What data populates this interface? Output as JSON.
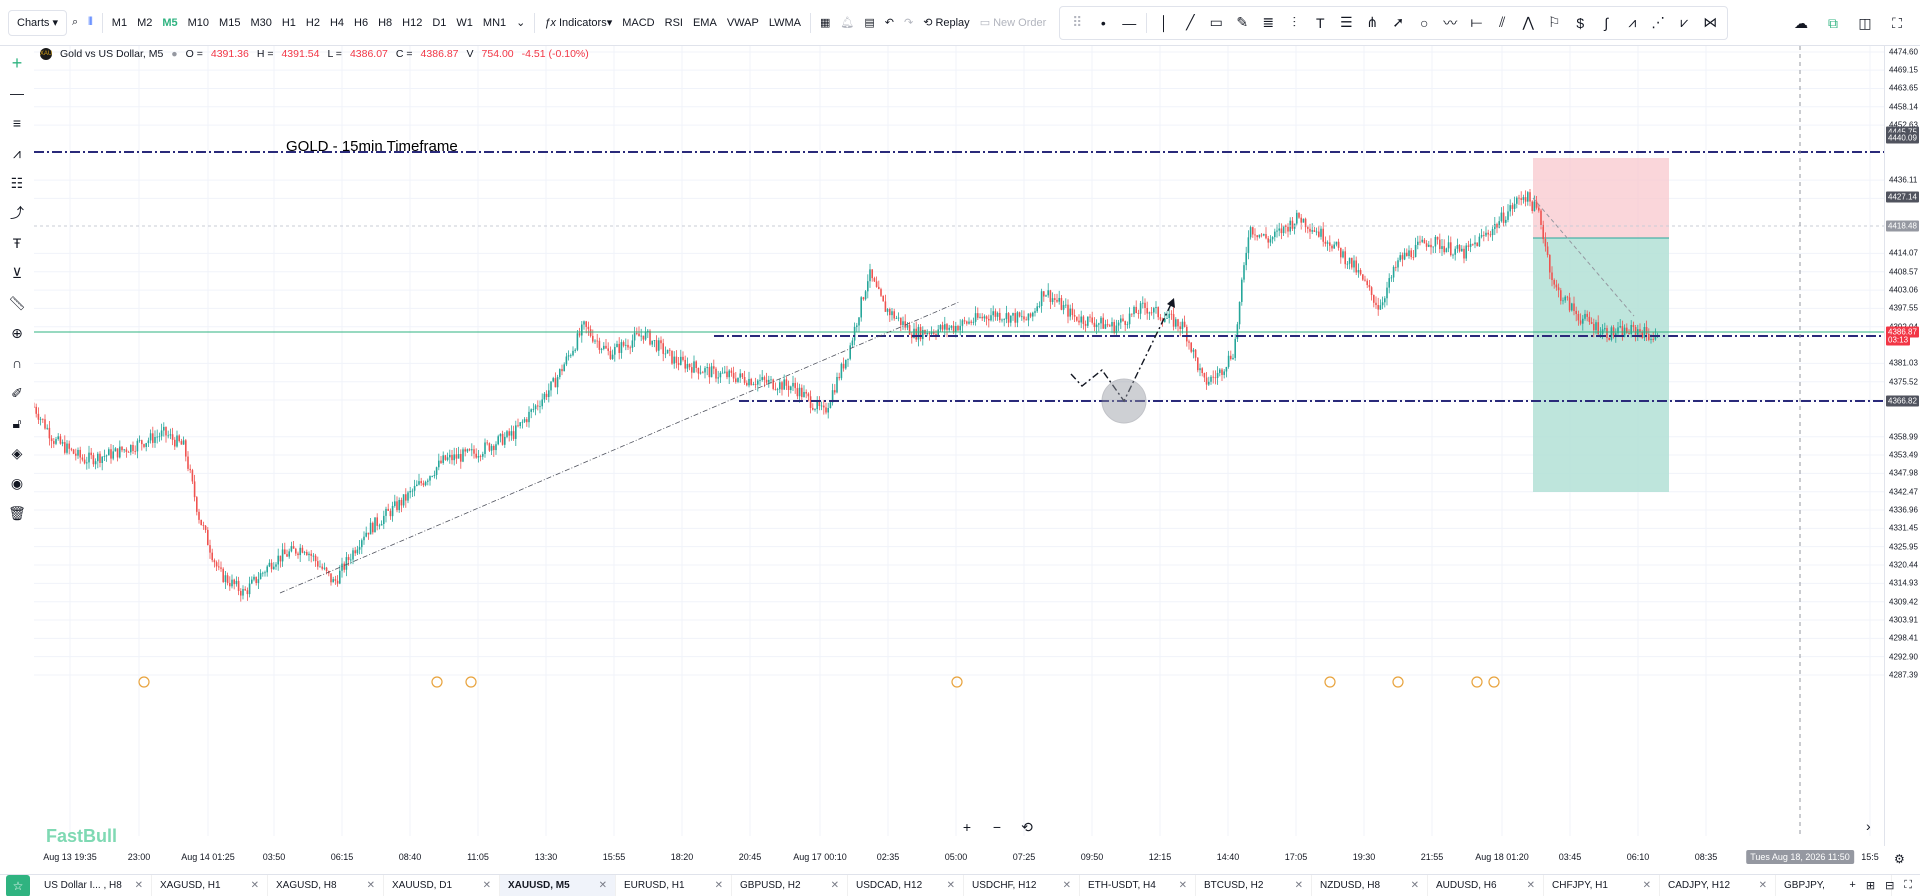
{
  "toolbar": {
    "charts_label": "Charts",
    "timeframes": [
      "M1",
      "M2",
      "M5",
      "M10",
      "M15",
      "M30",
      "H1",
      "H2",
      "H4",
      "H6",
      "H8",
      "H12",
      "D1",
      "W1",
      "MN1"
    ],
    "active_timeframe": "M5",
    "indicators_label": "Indicators",
    "indicators": [
      "MACD",
      "RSI",
      "EMA",
      "VWAP",
      "LWMA"
    ],
    "replay_label": "Replay",
    "new_order_label": "New Order"
  },
  "legend": {
    "symbol": "Gold vs US Dollar, M5",
    "o_label": "O =",
    "o_value": "4391.36",
    "h_label": "H =",
    "h_value": "4391.54",
    "l_label": "L =",
    "l_value": "4386.07",
    "c_label": "C =",
    "c_value": "4386.87",
    "v_label": "V",
    "v_value": "754.00",
    "change": "-4.51 (-0.10%)"
  },
  "annotation_text": "GOLD - 15min Timeframe",
  "watermark": "FastBull",
  "price_axis": {
    "labels": [
      "4474.60",
      "4469.15",
      "4463.65",
      "4458.14",
      "4452.63",
      "4436.11",
      "4430.60",
      "4414.07",
      "4408.57",
      "4403.06",
      "4397.55",
      "4392.04",
      "4381.03",
      "4375.52",
      "4370.01",
      "4358.99",
      "4353.49",
      "4347.98",
      "4342.47",
      "4336.96",
      "4331.45",
      "4325.95",
      "4320.44",
      "4314.93",
      "4309.42",
      "4303.91",
      "4298.41",
      "4292.90",
      "4287.39"
    ],
    "tags": [
      {
        "value": "4445.75",
        "color": "#50535e"
      },
      {
        "value": "4440.09",
        "color": "#50535e"
      },
      {
        "value": "4427.14",
        "color": "#50535e"
      },
      {
        "value": "4418.48",
        "color": "#9598a1"
      },
      {
        "value": "4386.87",
        "color": "#f23645"
      },
      {
        "value": "03:13",
        "color": "#f23645"
      },
      {
        "value": "4366.82",
        "color": "#50535e"
      }
    ]
  },
  "time_axis": {
    "labels": [
      "Aug 13 19:35",
      "23:00",
      "Aug 14 01:25",
      "03:50",
      "06:15",
      "08:40",
      "11:05",
      "13:30",
      "15:55",
      "18:20",
      "20:45",
      "Aug 17 00:10",
      "02:35",
      "05:00",
      "07:25",
      "09:50",
      "12:15",
      "14:40",
      "17:05",
      "19:30",
      "21:55",
      "Aug 18 01:20",
      "03:45",
      "06:10",
      "08:35",
      "15:5"
    ],
    "cursor_label": "Tues Aug 18, 2026 11:50"
  },
  "tabs": [
    {
      "label": "US Dollar I... , H8",
      "active": false
    },
    {
      "label": "XAGUSD, H1",
      "active": false
    },
    {
      "label": "XAGUSD, H8",
      "active": false
    },
    {
      "label": "XAUUSD, D1",
      "active": false
    },
    {
      "label": "XAUUSD, M5",
      "active": true
    },
    {
      "label": "EURUSD, H1",
      "active": false
    },
    {
      "label": "GBPUSD, H2",
      "active": false
    },
    {
      "label": "USDCAD, H12",
      "active": false
    },
    {
      "label": "USDCHF, H12",
      "active": false
    },
    {
      "label": "ETH-USDT, H4",
      "active": false
    },
    {
      "label": "BTCUSD, H2",
      "active": false
    },
    {
      "label": "NZDUSD, H8",
      "active": false
    },
    {
      "label": "AUDUSD, H6",
      "active": false
    },
    {
      "label": "CHFJPY, H1",
      "active": false
    },
    {
      "label": "CADJPY, H12",
      "active": false
    },
    {
      "label": "GBPJPY,",
      "active": false
    }
  ],
  "colors": {
    "up": "#26a69a",
    "down": "#ef5350",
    "level_line": "#2a2a7a",
    "current_price_line": "#2fb380",
    "stop_zone": "#f8c8cd",
    "target_zone": "#b3e0d6"
  }
}
